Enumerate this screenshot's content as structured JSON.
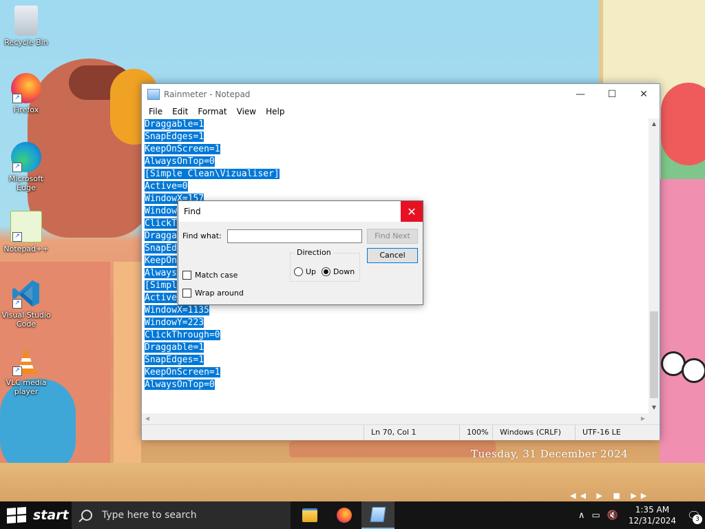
{
  "desktop": {
    "date_overlay": "Tuesday, 31 December 2024",
    "media_controls": "◀◀ ▶ ■ ▶▶",
    "icons": [
      {
        "label": "Recycle Bin"
      },
      {
        "label": "Firefox"
      },
      {
        "label": "Microsoft Edge"
      },
      {
        "label": "Notepad++"
      },
      {
        "label": "Visual Studio Code"
      },
      {
        "label": "VLC media player"
      }
    ]
  },
  "notepad": {
    "title": "Rainmeter - Notepad",
    "minimize": "—",
    "maximize": "☐",
    "close": "✕",
    "menu": [
      "File",
      "Edit",
      "Format",
      "View",
      "Help"
    ],
    "lines": [
      "Draggable=1",
      "SnapEdges=1",
      "KeepOnScreen=1",
      "AlwaysOnTop=0",
      "[Simple Clean\\Vizualiser]",
      "Active=0",
      "WindowX=157",
      "Window",
      "ClickT",
      "Dragga",
      "SnapEd",
      "KeepOn",
      "Always",
      "[Simpl",
      "Active",
      "WindowX=1135",
      "WindowY=223",
      "ClickThrough=0",
      "Draggable=1",
      "SnapEdges=1",
      "KeepOnScreen=1",
      "AlwaysOnTop=0"
    ],
    "status": {
      "position": "Ln 70, Col 1",
      "zoom": "100%",
      "line_ending": "Windows (CRLF)",
      "encoding": "UTF-16 LE"
    }
  },
  "find_dialog": {
    "title": "Find",
    "close": "✕",
    "find_what_label": "Find what:",
    "find_what_value": "",
    "find_next_label": "Find Next",
    "cancel_label": "Cancel",
    "direction_label": "Direction",
    "up_label": "Up",
    "down_label": "Down",
    "direction_selected": "Down",
    "match_case_label": "Match case",
    "match_case_checked": false,
    "wrap_around_label": "Wrap around",
    "wrap_around_checked": false
  },
  "taskbar": {
    "start_label": "start",
    "search_placeholder": "Type here to search",
    "time": "1:35 AM",
    "date": "12/31/2024",
    "notification_count": "3",
    "tray_chevron": "∧",
    "tray_network": "▭",
    "tray_volume": "🔇"
  },
  "colors": {
    "selection": "#0078d7",
    "close_red": "#e81123",
    "taskbar": "#141414"
  }
}
